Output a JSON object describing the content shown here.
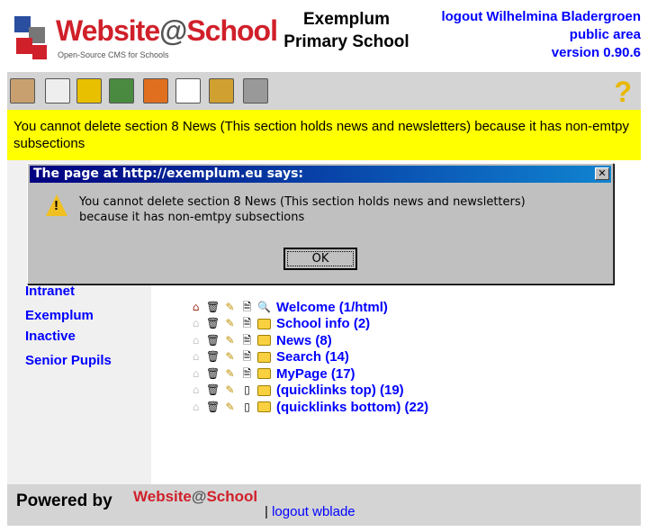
{
  "header": {
    "logo_text": "Website@School",
    "logo_sub": "Open-Source CMS for Schools",
    "school_line1": "Exemplum",
    "school_line2": "Primary School",
    "logout_label": "logout Wilhelmina Bladergroen",
    "area": "public area",
    "version": "version 0.90.6"
  },
  "toolbar": {
    "icons": [
      "site-icon",
      "page-icon",
      "save-icon",
      "modules-icon",
      "users-icon",
      "check-icon",
      "stats-icon",
      "tools-icon"
    ],
    "help": "?"
  },
  "message": "You cannot delete section 8 News (This section holds news and newsletters) because it has non-emtpy subsections",
  "sidebar": {
    "items": [
      "Intranet",
      "Exemplum",
      "Inactive",
      "Senior Pupils"
    ]
  },
  "tree": [
    {
      "label": "Welcome (1/html)",
      "home": true,
      "type": "page"
    },
    {
      "label": "School info (2)",
      "home": false,
      "type": "section"
    },
    {
      "label": "News (8)",
      "home": false,
      "type": "section"
    },
    {
      "label": "Search (14)",
      "home": false,
      "type": "section"
    },
    {
      "label": "MyPage (17)",
      "home": false,
      "type": "section"
    },
    {
      "label": "(quicklinks top) (19)",
      "home": false,
      "type": "section"
    },
    {
      "label": "(quicklinks bottom) (22)",
      "home": false,
      "type": "section"
    }
  ],
  "footer": {
    "powered": "Powered by",
    "logo": "Website@School",
    "sep": "|",
    "logout": "logout wblade"
  },
  "dialog": {
    "title": "The page at http://exemplum.eu says:",
    "line1": "You cannot delete section 8 News (This section holds news and newsletters)",
    "line2": "because it has non-emtpy subsections",
    "ok": "OK",
    "close": "✕"
  }
}
